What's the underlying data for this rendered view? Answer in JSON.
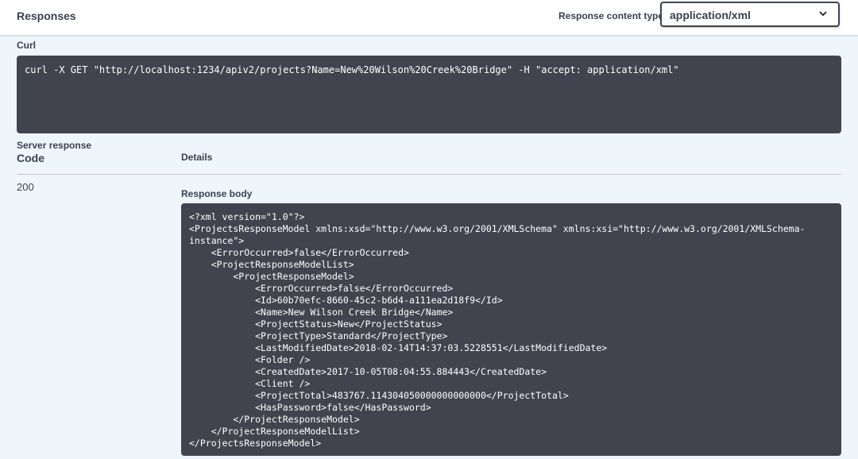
{
  "header": {
    "title": "Responses",
    "content_type_label": "Response content type",
    "content_type_value": "application/xml"
  },
  "curl": {
    "label": "Curl",
    "command": "curl -X GET \"http://localhost:1234/apiv2/projects?Name=New%20Wilson%20Creek%20Bridge\" -H \"accept: application/xml\""
  },
  "server_response": {
    "label": "Server response",
    "code_header": "Code",
    "details_header": "Details",
    "code": "200",
    "body_label": "Response body",
    "body": "<?xml version=\"1.0\"?>\n<ProjectsResponseModel xmlns:xsd=\"http://www.w3.org/2001/XMLSchema\" xmlns:xsi=\"http://www.w3.org/2001/XMLSchema-\ninstance\">\n    <ErrorOccurred>false</ErrorOccurred>\n    <ProjectResponseModelList>\n        <ProjectResponseModel>\n            <ErrorOccurred>false</ErrorOccurred>\n            <Id>60b70efc-8660-45c2-b6d4-a111ea2d18f9</Id>\n            <Name>New Wilson Creek Bridge</Name>\n            <ProjectStatus>New</ProjectStatus>\n            <ProjectType>Standard</ProjectType>\n            <LastModifiedDate>2018-02-14T14:37:03.5228551</LastModifiedDate>\n            <Folder />\n            <CreatedDate>2017-10-05T08:04:55.884443</CreatedDate>\n            <Client />\n            <ProjectTotal>483767.114304050000000000000</ProjectTotal>\n            <HasPassword>false</HasPassword>\n        </ProjectResponseModel>\n    </ProjectResponseModelList>\n</ProjectsResponseModel>"
  }
}
